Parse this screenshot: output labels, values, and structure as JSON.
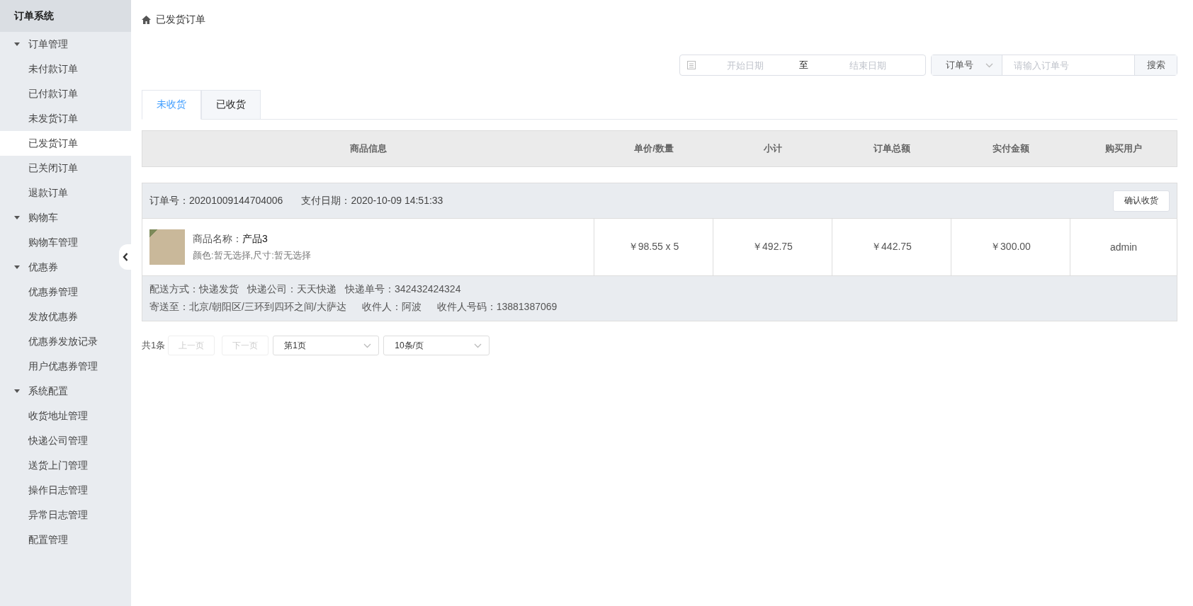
{
  "sidebar": {
    "title": "订单系统",
    "groups": [
      {
        "label": "订单管理",
        "expanded": true,
        "items": [
          {
            "label": "未付款订单",
            "selected": false
          },
          {
            "label": "已付款订单",
            "selected": false
          },
          {
            "label": "未发货订单",
            "selected": false
          },
          {
            "label": "已发货订单",
            "selected": true
          },
          {
            "label": "已关闭订单",
            "selected": false
          },
          {
            "label": "退款订单",
            "selected": false
          }
        ]
      },
      {
        "label": "购物车",
        "expanded": true,
        "items": [
          {
            "label": "购物车管理",
            "selected": false
          }
        ]
      },
      {
        "label": "优惠券",
        "expanded": true,
        "items": [
          {
            "label": "优惠券管理",
            "selected": false
          },
          {
            "label": "发放优惠券",
            "selected": false
          },
          {
            "label": "优惠券发放记录",
            "selected": false
          },
          {
            "label": "用户优惠券管理",
            "selected": false
          }
        ]
      },
      {
        "label": "系统配置",
        "expanded": true,
        "items": [
          {
            "label": "收货地址管理",
            "selected": false
          },
          {
            "label": "快递公司管理",
            "selected": false
          },
          {
            "label": "送货上门管理",
            "selected": false
          },
          {
            "label": "操作日志管理",
            "selected": false
          },
          {
            "label": "异常日志管理",
            "selected": false
          },
          {
            "label": "配置管理",
            "selected": false
          }
        ]
      }
    ]
  },
  "breadcrumb": "已发货订单",
  "filter": {
    "start_placeholder": "开始日期",
    "separator": "至",
    "end_placeholder": "结束日期",
    "search_type": "订单号",
    "search_placeholder": "请输入订单号",
    "search_button": "搜索"
  },
  "tabs": [
    {
      "label": "未收货",
      "selected": true
    },
    {
      "label": "已收货",
      "selected": false
    }
  ],
  "table": {
    "columns": [
      "商品信息",
      "单价/数量",
      "小计",
      "订单总额",
      "实付金额",
      "购买用户"
    ],
    "orders": [
      {
        "order_no": "订单号：20201009144704006",
        "pay_date": "支付日期：2020-10-09 14:51:33",
        "action": "确认收货",
        "product_label": "商品名称：",
        "product_name": "产品3",
        "product_spec": "颜色:暂无选择,尺寸:暂无选择",
        "cells": [
          "￥98.55 x 5",
          "￥492.75",
          "￥442.75",
          "￥300.00",
          "admin"
        ],
        "delivery": [
          "配送方式：快递发货",
          "快递公司：天天快递",
          "快递单号：342432424324"
        ],
        "address": [
          "寄送至：北京/朝阳区/三环到四环之间/大萨达",
          "收件人：阿波",
          "收件人号码：13881387069"
        ]
      }
    ]
  },
  "pagination": {
    "total": "共1条",
    "prev": "上一页",
    "next": "下一页",
    "page": "第1页",
    "page_size": "10条/页"
  }
}
